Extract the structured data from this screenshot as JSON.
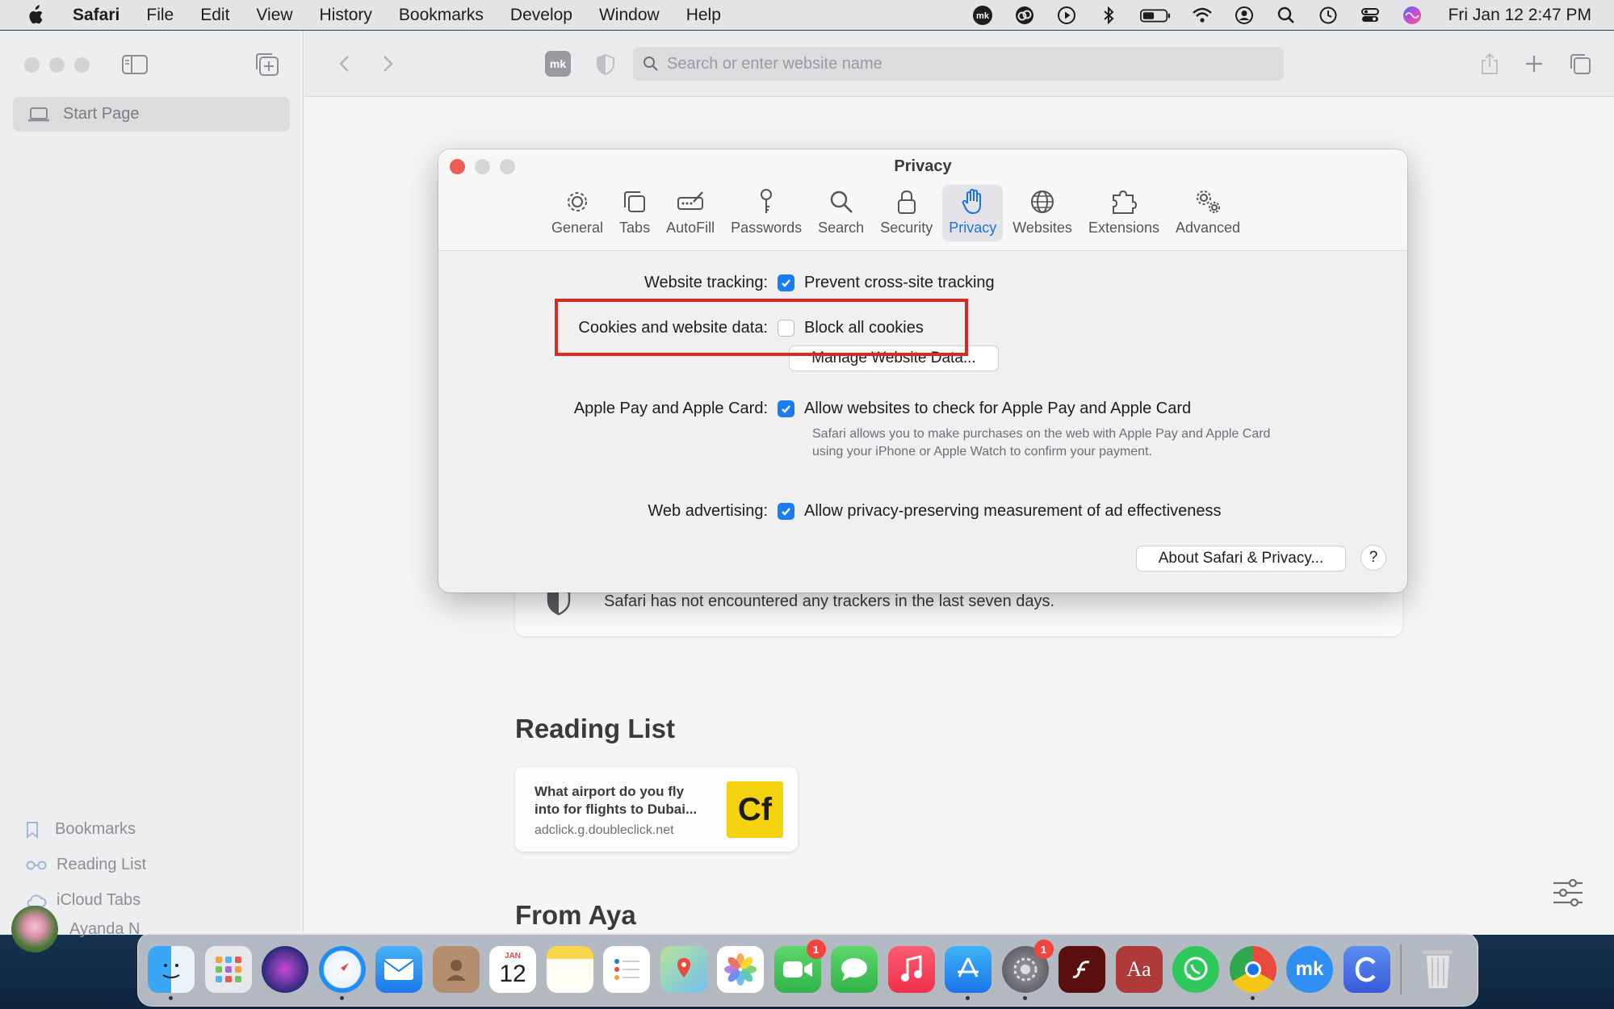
{
  "menubar": {
    "app_name": "Safari",
    "items": [
      "File",
      "Edit",
      "View",
      "History",
      "Bookmarks",
      "Develop",
      "Window",
      "Help"
    ],
    "clock": "Fri Jan 12  2:47 PM"
  },
  "sidebar": {
    "start_page": "Start Page",
    "bookmarks": "Bookmarks",
    "reading_list": "Reading List",
    "icloud_tabs": "iCloud Tabs",
    "user_name": "Ayanda N"
  },
  "toolbar": {
    "extension_label": "mk",
    "address_placeholder": "Search or enter website name"
  },
  "content": {
    "tracker_message": "Safari has not encountered any trackers in the last seven days.",
    "reading_list_title": "Reading List",
    "reading_item": {
      "title": "What airport do you fly into for flights to Dubai...",
      "url": "adclick.g.doubleclick.net",
      "thumb_text": "Cf"
    },
    "from_title": "From Aya"
  },
  "dialog": {
    "title": "Privacy",
    "tabs": [
      "General",
      "Tabs",
      "AutoFill",
      "Passwords",
      "Search",
      "Security",
      "Privacy",
      "Websites",
      "Extensions",
      "Advanced"
    ],
    "active_tab": "Privacy",
    "website_tracking": {
      "label": "Website tracking:",
      "option": "Prevent cross-site tracking",
      "checked": true
    },
    "cookies": {
      "label": "Cookies and website data:",
      "option": "Block all cookies",
      "checked": false,
      "manage_button": "Manage Website Data..."
    },
    "apple_pay": {
      "label": "Apple Pay and Apple Card:",
      "option": "Allow websites to check for Apple Pay and Apple Card",
      "checked": true,
      "description": "Safari allows you to make purchases on the web with Apple Pay and Apple Card using your iPhone or Apple Watch to confirm your payment."
    },
    "web_advertising": {
      "label": "Web advertising:",
      "option": "Allow privacy-preserving measurement of ad effectiveness",
      "checked": true
    },
    "about_button": "About Safari & Privacy...",
    "help_button": "?"
  },
  "dock": {
    "calendar_month": "JAN",
    "calendar_day": "12",
    "facetime_badge": "1",
    "settings_badge": "1",
    "dictionary_label": "Aa",
    "mk_label": "mk"
  },
  "colors": {
    "accent": "#1a7cf0",
    "highlight": "#d62b22",
    "close_red": "#ee5b52",
    "minimize": "#d3d3d5"
  }
}
